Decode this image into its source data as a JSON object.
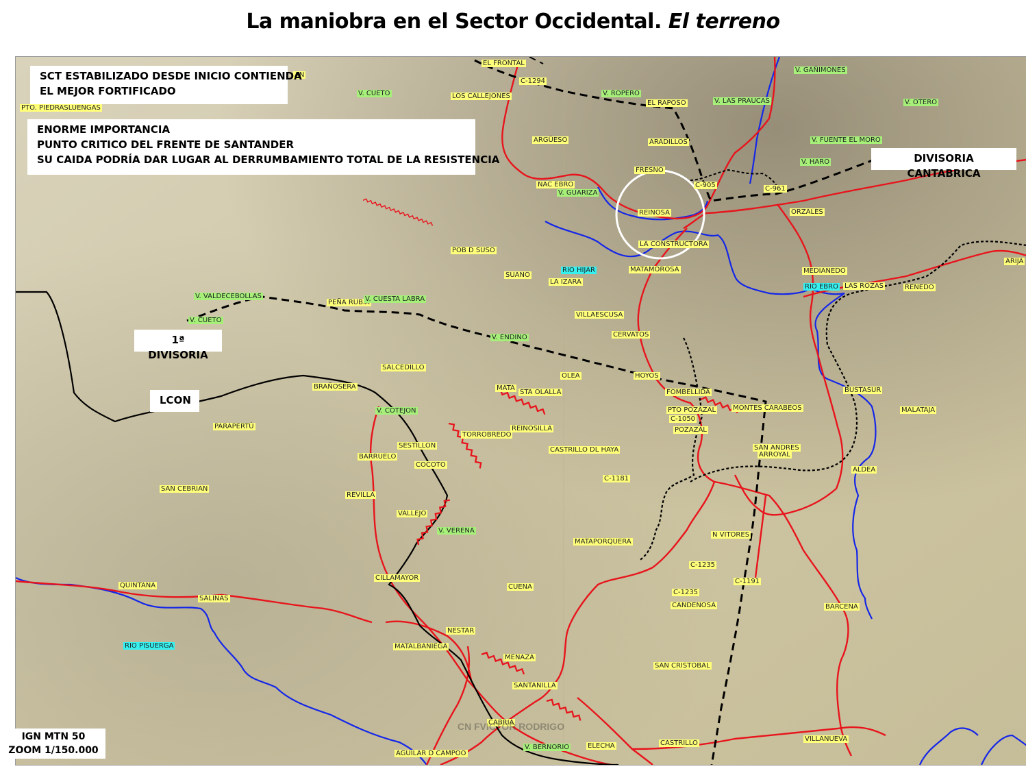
{
  "title": {
    "main": "La maniobra en el Sector Occidental.",
    "italic": "El terreno"
  },
  "notes": {
    "sct": [
      "SCT ESTABILIZADO DESDE INICIO CONTIENDA",
      "EL MEJOR FORTIFICADO"
    ],
    "importance": [
      "ENORME IMPORTANCIA",
      "PUNTO CRITICO DEL FRENTE DE SANTANDER",
      "SU CAIDA PODRÍA DAR LUGAR AL DERRUMBAMIENTO TOTAL DE LA RESISTENCIA"
    ],
    "divisoria_cantabrica": "DIVISORIA CANTABRICA",
    "primera_divisoria": "1ª DIVISORIA",
    "lcon": "LCON"
  },
  "scale": {
    "line1": "IGN MTN 50",
    "line2": "ZOOM 1/150.000"
  },
  "watermark": "CN FVICTOR RODRIGO",
  "colors": {
    "road": "#e8141c",
    "river": "#1426e8",
    "front_line": "#000000",
    "highlight_circle": "#ffffff",
    "label_village": "#ffff7a",
    "label_peak": "#a6f07a",
    "label_river": "#36f0f0"
  },
  "places": {
    "frontal": "EL FRONTAL",
    "c1294": "C-1294",
    "cueto_n": "V. CUETO",
    "callejones": "LOS CALLEJONES",
    "ropero": "V. ROPERO",
    "raposo": "EL RAPOSO",
    "praucas": "V. LAS PRAUCAS",
    "ganimones": "V. GAÑIMONES",
    "otero": "V. OTERO",
    "piedrasluengas": "PTO. PIEDRASLUENGAS",
    "argueso": "ARGÜESO",
    "aradillos": "ARADILLOS",
    "fuente_moro": "V. FUENTE EL MORO",
    "haro": "V. HARO",
    "fresno": "FRESNO",
    "nacebro": "NAC EBRO",
    "c905": "C-905",
    "c961": "C-961",
    "guariza": "V. GUARIZA",
    "reinosa": "REINOSA",
    "orzales": "ORZALES",
    "construct": "LA CONSTRUCTORA",
    "pobsuso": "POB D SUSO",
    "suano": "SUANO",
    "riohijar": "RIO HIJAR",
    "izara": "LA IZARA",
    "matamorosa": "MATAMOROSA",
    "medianedo": "MEDIANEDO",
    "arija": "ARIJA",
    "rioebro": "RIO EBRO",
    "rozas": "LAS ROZAS",
    "renedo": "RENEDO",
    "valdecebollas": "V. VALDECEBOLLAS",
    "penarubia": "PEÑA RUBIA",
    "cuestalabra": "V. CUESTA LABRA",
    "cueto_w": "V. CUETO",
    "villaescusa": "VILLAESCUSA",
    "cervatos": "CERVATOS",
    "endino": "V. ENDINO",
    "salcedillo": "SALCEDILLO",
    "olea": "OLEA",
    "hoyos": "HOYOS",
    "branosera": "BRAÑOSERA",
    "mata": "MATA",
    "staolalla": "STA OLALLA",
    "fombellida": "FOMBELLIDA",
    "ptopozazal": "PTO POZAZAL",
    "montes": "MONTES CARABEOS",
    "bustasur": "BUSTASUR",
    "cotejon": "V. COTEJON",
    "c1050": "C-1050",
    "malataja": "MALATAJA",
    "parapertu": "PARAPERTÚ",
    "torrobredo": "TORROBREDO",
    "reinosilla": "REINOSILLA",
    "pozazal": "POZAZAL",
    "sestillon": "SESTILLON",
    "sanandres": "SAN ANDRES",
    "arroyal": "ARROYAL",
    "barruelo": "BARRUELO",
    "castrillo_haya": "CASTRILLO DL HAYA",
    "cocoto": "COCOTO",
    "aldea": "ALDEA",
    "c1181": "C-1181",
    "sancebrian": "SAN CEBRIAN",
    "revilla": "REVILLA",
    "vallejo": "VALLEJO",
    "verena": "V. VERENA",
    "vitores": "N VITORES",
    "mataporquera": "MATAPORQUERA",
    "c1235a": "C-1235",
    "c1191": "C-1191",
    "cillamayor": "CILLAMAYOR",
    "cuena": "CUENA",
    "c1235b": "C-1235",
    "quintana": "QUINTANA",
    "salinas": "SALINAS",
    "candenosa": "CANDENOSA",
    "barcena": "BARCENA",
    "nestar": "NESTAR",
    "riopisuerga": "RIO PISUERGA",
    "matalbaniega": "MATALBANIEGA",
    "menaza": "MENAZA",
    "sancristobal": "SAN CRISTOBAL",
    "santanilla": "SANTANILLA",
    "cabria": "CABRIA",
    "castrillo": "CASTRILLO",
    "villanueva": "VILLANUEVA",
    "bernorio": "V. BERNORIO",
    "elecha": "ELECHA",
    "aguilar": "AGUILAR D CAMPOO",
    "an": "AN"
  }
}
